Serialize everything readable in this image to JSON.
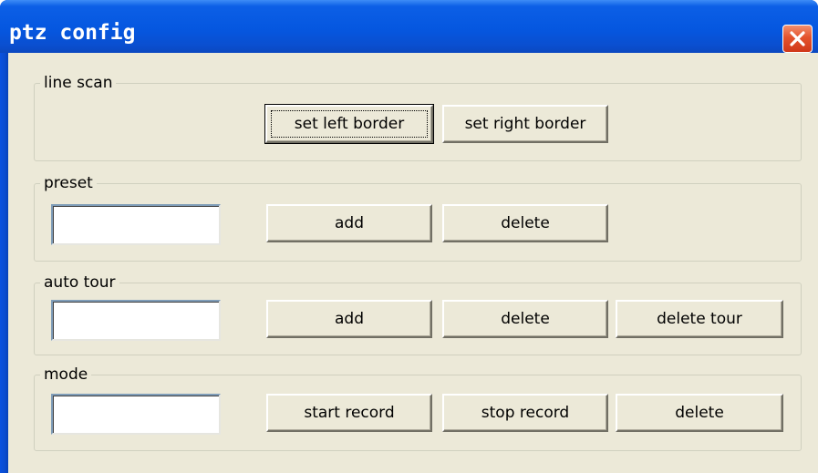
{
  "window": {
    "title": "ptz config"
  },
  "line_scan": {
    "label": "line scan",
    "set_left_border": "set left border",
    "set_right_border": "set right border"
  },
  "preset": {
    "label": "preset",
    "input_value": "",
    "add": "add",
    "delete": "delete"
  },
  "auto_tour": {
    "label": "auto tour",
    "input_value": "",
    "add": "add",
    "delete": "delete",
    "delete_tour": "delete tour"
  },
  "mode": {
    "label": "mode",
    "input_value": "",
    "start_record": "start record",
    "stop_record": "stop record",
    "delete": "delete"
  },
  "icons": {
    "close": "close-icon"
  },
  "colors": {
    "titlebar": "#0557e0",
    "dialog_bg": "#ece9d8",
    "close_button": "#e4532d"
  }
}
